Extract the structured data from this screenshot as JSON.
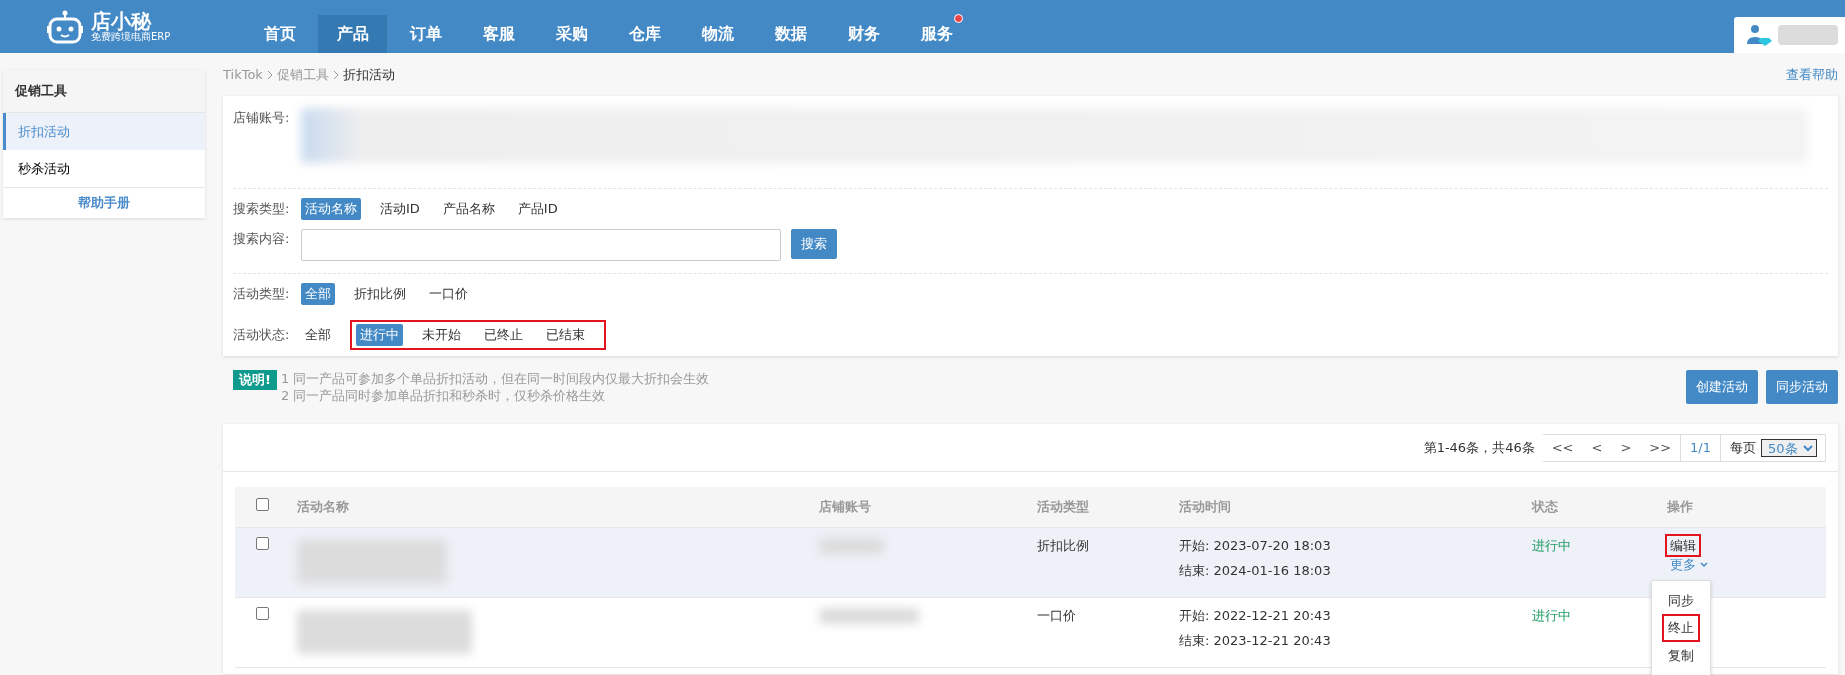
{
  "header": {
    "logo": {
      "name": "店小秘",
      "tagline": "免费跨境电商ERP"
    },
    "nav": [
      {
        "label": "首页",
        "selected": false,
        "dot": false
      },
      {
        "label": "产品",
        "selected": true,
        "dot": false
      },
      {
        "label": "订单",
        "selected": false,
        "dot": false
      },
      {
        "label": "客服",
        "selected": false,
        "dot": false
      },
      {
        "label": "采购",
        "selected": false,
        "dot": false
      },
      {
        "label": "仓库",
        "selected": false,
        "dot": false
      },
      {
        "label": "物流",
        "selected": false,
        "dot": false
      },
      {
        "label": "数据",
        "selected": false,
        "dot": false
      },
      {
        "label": "财务",
        "selected": false,
        "dot": false
      },
      {
        "label": "服务",
        "selected": false,
        "dot": true
      }
    ]
  },
  "sidebar": {
    "title": "促销工具",
    "items": [
      {
        "label": "折扣活动",
        "selected": true
      },
      {
        "label": "秒杀活动",
        "selected": false
      }
    ],
    "help": "帮助手册"
  },
  "breadcrumb": [
    "TikTok",
    "促销工具",
    "折扣活动"
  ],
  "help_link": "查看帮助",
  "filters": {
    "shop_label": "店铺账号:",
    "search_type": {
      "label": "搜索类型:",
      "highlighted": false,
      "options": [
        {
          "label": "活动名称",
          "selected": true
        },
        {
          "label": "活动ID",
          "selected": false
        },
        {
          "label": "产品名称",
          "selected": false
        },
        {
          "label": "产品ID",
          "selected": false
        }
      ]
    },
    "search_content": {
      "label": "搜索内容:",
      "button": "搜索"
    },
    "activity_type": {
      "label": "活动类型:",
      "highlighted": false,
      "options": [
        {
          "label": "全部",
          "selected": true
        },
        {
          "label": "折扣比例",
          "selected": false
        },
        {
          "label": "一口价",
          "selected": false
        }
      ]
    },
    "activity_status": {
      "label": "活动状态:",
      "all": {
        "label": "全部",
        "selected": false
      },
      "highlighted": true,
      "options": [
        {
          "label": "进行中",
          "selected": true
        },
        {
          "label": "未开始",
          "selected": false
        },
        {
          "label": "已终止",
          "selected": false
        },
        {
          "label": "已结束",
          "selected": false
        }
      ]
    }
  },
  "notice": {
    "badge": "说明!",
    "lines": [
      "1 同一产品可参加多个单品折扣活动，但在同一时间段内仅最大折扣会生效",
      "2 同一产品同时参加单品折扣和秒杀时，仅秒杀价格生效"
    ]
  },
  "actions": [
    "创建活动",
    "同步活动"
  ],
  "pager": {
    "summary": "第1-46条，共46条",
    "buttons": [
      "<<",
      "<",
      ">",
      ">>"
    ],
    "page": "1/1",
    "per_page_label": "每页",
    "per_page": "50条"
  },
  "table": {
    "header_checked": false,
    "columns": [
      "活动名称",
      "店铺账号",
      "活动类型",
      "活动时间",
      "状态",
      "操作"
    ],
    "rows": [
      {
        "checked": false,
        "selected": true,
        "type": "折扣比例",
        "start": "开始: 2023-07-20 18:03",
        "end": "结束: 2024-01-16 18:03",
        "status": "进行中",
        "edit": {
          "label": "编辑",
          "highlighted": true
        },
        "more": "更多",
        "menu": [
          {
            "label": "同步",
            "highlighted": false
          },
          {
            "label": "终止",
            "highlighted": true
          },
          {
            "label": "复制",
            "highlighted": false
          }
        ]
      },
      {
        "checked": false,
        "selected": false,
        "type": "一口价",
        "start": "开始: 2022-12-21 20:43",
        "end": "结束: 2023-12-21 20:43",
        "status": "进行中"
      }
    ]
  }
}
